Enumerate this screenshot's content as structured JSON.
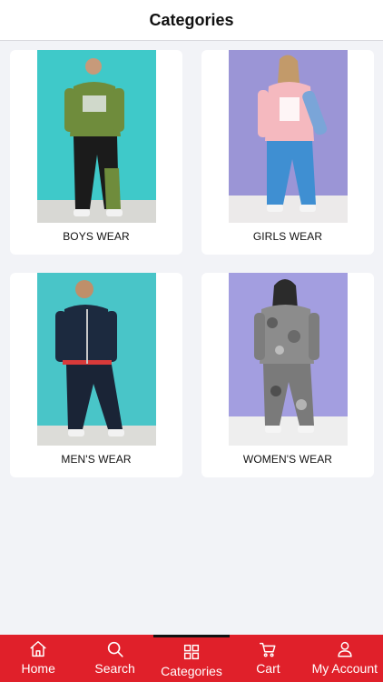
{
  "header": {
    "title": "Categories"
  },
  "categories": [
    {
      "label": "BOYS WEAR"
    },
    {
      "label": "GIRLS WEAR"
    },
    {
      "label": "MEN'S WEAR"
    },
    {
      "label": "WOMEN'S WEAR"
    }
  ],
  "tabbar": {
    "active": "Categories",
    "accent": "#e0202a",
    "items": [
      {
        "label": "Home",
        "icon": "home-icon"
      },
      {
        "label": "Search",
        "icon": "search-icon"
      },
      {
        "label": "Categories",
        "icon": "grid-icon"
      },
      {
        "label": "Cart",
        "icon": "cart-icon"
      },
      {
        "label": "My Account",
        "icon": "user-icon"
      }
    ]
  }
}
